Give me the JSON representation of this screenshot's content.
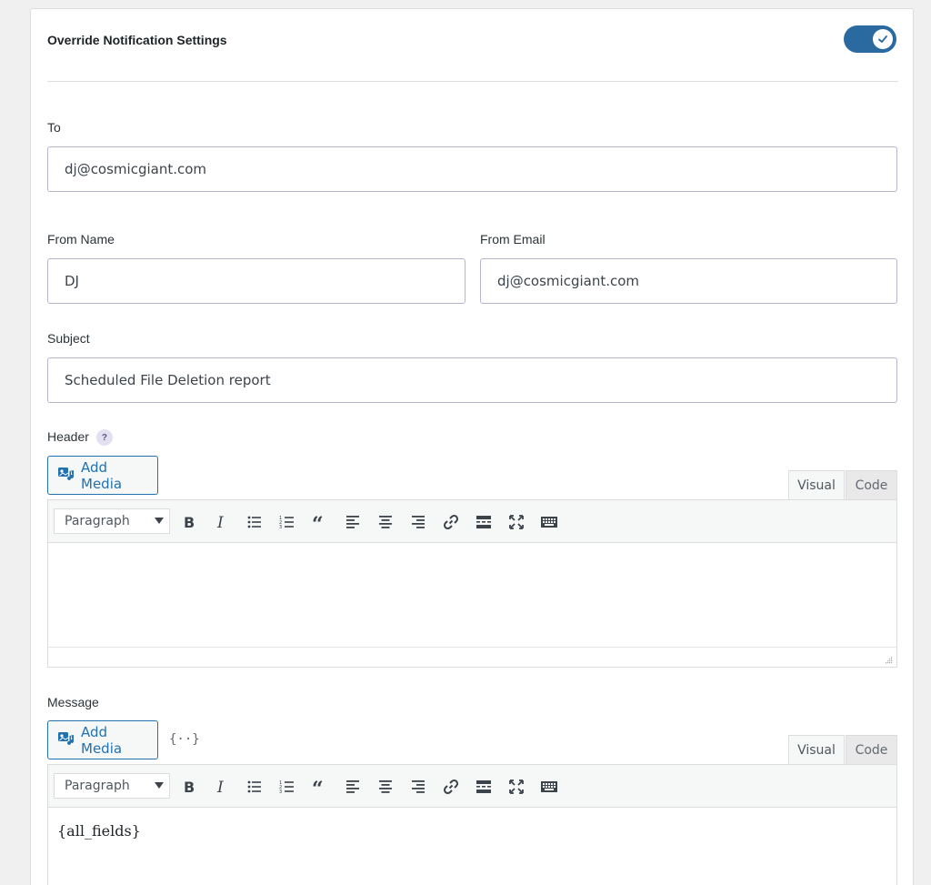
{
  "section": {
    "title": "Override Notification Settings",
    "toggle_on": true
  },
  "fields": {
    "to": {
      "label": "To",
      "value": "dj@cosmicgiant.com"
    },
    "from_name": {
      "label": "From Name",
      "value": "DJ"
    },
    "from_email": {
      "label": "From Email",
      "value": "dj@cosmicgiant.com"
    },
    "subject": {
      "label": "Subject",
      "value": "Scheduled File Deletion report"
    }
  },
  "header_editor": {
    "label": "Header",
    "help": "?",
    "add_media": "Add Media",
    "tab_visual": "Visual",
    "tab_code": "Code",
    "format": "Paragraph",
    "content": ""
  },
  "message_editor": {
    "label": "Message",
    "add_media": "Add Media",
    "merge_tags": "{··}",
    "tab_visual": "Visual",
    "tab_code": "Code",
    "format": "Paragraph",
    "content": "{all_fields}"
  },
  "toolbar_icons": [
    "bold-icon",
    "italic-icon",
    "bulleted-list-icon",
    "numbered-list-icon",
    "blockquote-icon",
    "align-left-icon",
    "align-center-icon",
    "align-right-icon",
    "link-icon",
    "read-more-icon",
    "fullscreen-icon",
    "toolbar-toggle-icon"
  ],
  "colors": {
    "toggle": "#2a6aa0",
    "accent": "#2271b1",
    "input_border": "#b8b4cf"
  }
}
